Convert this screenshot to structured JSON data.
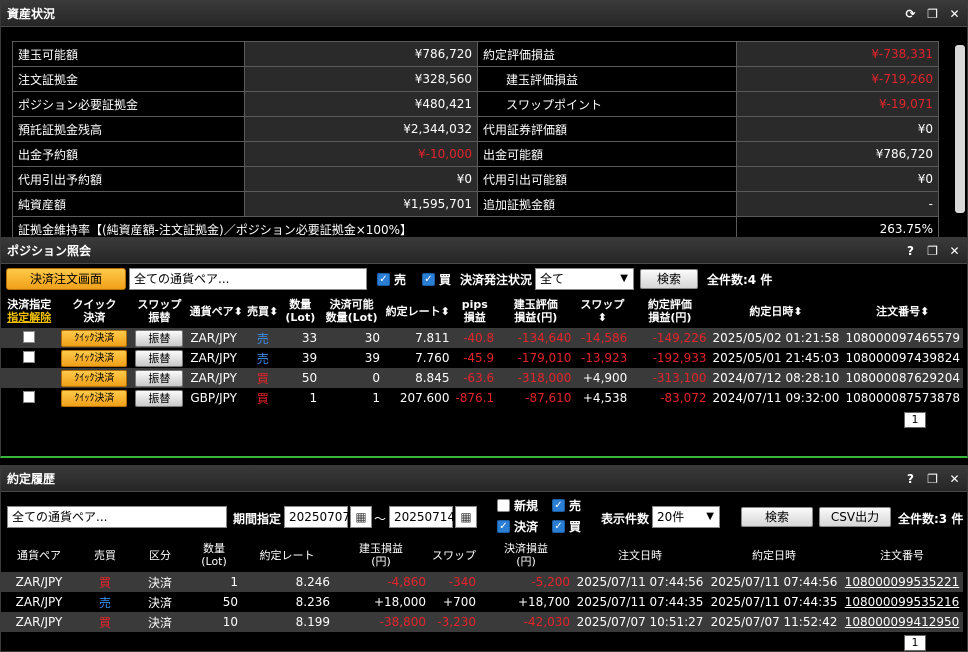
{
  "asset": {
    "title": "資産状況",
    "rows": [
      {
        "l1": "建玉可能額",
        "v1": "¥786,720",
        "v1_color": "white",
        "l2": "約定評価損益",
        "v2": "¥-738,331",
        "v2_color": "red",
        "indent2": false
      },
      {
        "l1": "注文証拠金",
        "v1": "¥328,560",
        "v1_color": "white",
        "l2": "建玉評価損益",
        "v2": "¥-719,260",
        "v2_color": "red",
        "indent2": true
      },
      {
        "l1": "ポジション必要証拠金",
        "v1": "¥480,421",
        "v1_color": "white",
        "l2": "スワップポイント",
        "v2": "¥-19,071",
        "v2_color": "red",
        "indent2": true
      },
      {
        "l1": "預託証拠金残高",
        "v1": "¥2,344,032",
        "v1_color": "white",
        "l2": "代用証券評価額",
        "v2": "¥0",
        "v2_color": "white",
        "indent2": false
      },
      {
        "l1": "出金予約額",
        "v1": "¥-10,000",
        "v1_color": "red",
        "l2": "出金可能額",
        "v2": "¥786,720",
        "v2_color": "white",
        "indent2": false
      },
      {
        "l1": "代用引出予約額",
        "v1": "¥0",
        "v1_color": "white",
        "l2": "代用引出可能額",
        "v2": "¥0",
        "v2_color": "white",
        "indent2": false
      },
      {
        "l1": "純資産額",
        "v1": "¥1,595,701",
        "v1_color": "white",
        "l2": "追加証拠金額",
        "v2": "-",
        "v2_color": "white",
        "indent2": false
      }
    ],
    "maint_label": "証拠金維持率【(純資産額-注文証拠金)／ポジション必要証拠金×100%】",
    "maint_value": "263.75%"
  },
  "position": {
    "title": "ポジション照会",
    "order_screen_btn": "決済注文画面",
    "pair_placeholder": "全ての通貨ペア...",
    "sell_label": "売",
    "buy_label": "買",
    "status_label": "決済発注状況",
    "status_value": "全て",
    "search_btn": "検索",
    "count_label": "全件数:4 件",
    "headers": {
      "h1a": "決済指定",
      "h1b": "指定解除",
      "h2a": "クイック",
      "h2b": "決済",
      "h3a": "スワップ",
      "h3b": "振替",
      "h4": "通貨ペア",
      "h5": "売買",
      "h6a": "数量",
      "h6b": "(Lot)",
      "h7a": "決済可能",
      "h7b": "数量(Lot)",
      "h8": "約定レート",
      "h9a": "pips",
      "h9b": "損益",
      "h10a": "建玉評価",
      "h10b": "損益(円)",
      "h11": "スワップ",
      "h12a": "約定評価",
      "h12b": "損益(円)",
      "h13": "約定日時",
      "h14": "注文番号"
    },
    "quick_btn": "ｸｲｯｸ決済",
    "swap_btn": "振替",
    "rows": [
      {
        "pair": "ZAR/JPY",
        "side": "売",
        "qty": "33",
        "avail": "30",
        "rate": "7.811",
        "pips": "-40.8",
        "eval": "-134,640",
        "swap": "-14,586",
        "exec": "-149,226",
        "date": "2025/05/02 01:21:58",
        "order": "108000097465579"
      },
      {
        "pair": "ZAR/JPY",
        "side": "売",
        "qty": "39",
        "avail": "39",
        "rate": "7.760",
        "pips": "-45.9",
        "eval": "-179,010",
        "swap": "-13,923",
        "exec": "-192,933",
        "date": "2025/05/01 21:45:03",
        "order": "108000097439824"
      },
      {
        "pair": "ZAR/JPY",
        "side": "買",
        "qty": "50",
        "avail": "0",
        "rate": "8.845",
        "pips": "-63.6",
        "eval": "-318,000",
        "swap": "+4,900",
        "exec": "-313,100",
        "date": "2024/07/12 08:28:10",
        "order": "108000087629204"
      },
      {
        "pair": "GBP/JPY",
        "side": "買",
        "qty": "1",
        "avail": "1",
        "rate": "207.600",
        "pips": "-876.1",
        "eval": "-87,610",
        "swap": "+4,538",
        "exec": "-83,072",
        "date": "2024/07/11 09:32:00",
        "order": "108000087573878"
      }
    ],
    "page": "1"
  },
  "history": {
    "title": "約定履歴",
    "pair_placeholder": "全ての通貨ペア...",
    "period_label": "期間指定",
    "date_from": "20250707",
    "tilde": "～",
    "date_to": "20250714",
    "new_label": "新規",
    "settle_label": "決済",
    "sell_label": "売",
    "buy_label": "買",
    "display_label": "表示件数",
    "display_value": "20件",
    "search_btn": "検索",
    "csv_btn": "CSV出力",
    "count_label": "全件数:3 件",
    "headers": {
      "h1": "通貨ペア",
      "h2": "売買",
      "h3": "区分",
      "h4a": "数量",
      "h4b": "(Lot)",
      "h5": "約定レート",
      "h6a": "建玉損益",
      "h6b": "(円)",
      "h7": "スワップ",
      "h8a": "決済損益",
      "h8b": "(円)",
      "h9": "注文日時",
      "h10": "約定日時",
      "h11": "注文番号"
    },
    "rows": [
      {
        "pair": "ZAR/JPY",
        "side": "買",
        "kind": "決済",
        "qty": "1",
        "rate": "8.246",
        "pl": "-4,860",
        "swap": "-340",
        "settle": "-5,200",
        "odate": "2025/07/11 07:44:56",
        "edate": "2025/07/11 07:44:56",
        "order": "108000099535221"
      },
      {
        "pair": "ZAR/JPY",
        "side": "売",
        "kind": "決済",
        "qty": "50",
        "rate": "8.236",
        "pl": "+18,000",
        "swap": "+700",
        "settle": "+18,700",
        "odate": "2025/07/11 07:44:35",
        "edate": "2025/07/11 07:44:35",
        "order": "108000099535216"
      },
      {
        "pair": "ZAR/JPY",
        "side": "買",
        "kind": "決済",
        "qty": "10",
        "rate": "8.199",
        "pl": "-38,800",
        "swap": "-3,230",
        "settle": "-42,030",
        "odate": "2025/07/07 10:51:27",
        "edate": "2025/07/07 11:52:42",
        "order": "108000099412950"
      }
    ],
    "page": "1"
  },
  "colors": {
    "red": "#e5232a",
    "blue": "#3b8be8",
    "orange": "#f0a019",
    "green_border": "#38b53c"
  }
}
